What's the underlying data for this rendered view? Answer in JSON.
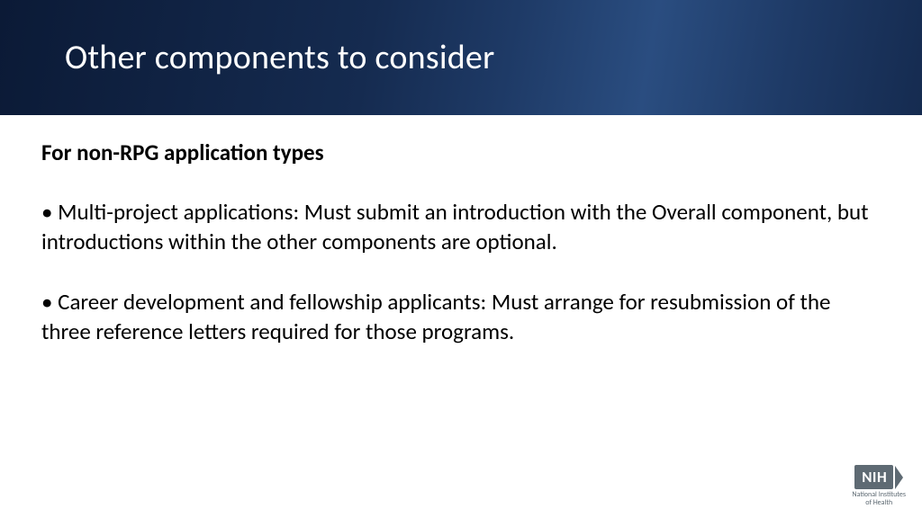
{
  "header": {
    "title": "Other components to consider"
  },
  "content": {
    "subheading": "For non-RPG application types",
    "bullets": [
      "Multi-project applications: Must submit an introduction with the Overall component, but introductions within the other components are optional.",
      "Career development and fellowship applicants: Must arrange for resubmission of the three reference letters required for those programs."
    ]
  },
  "logo": {
    "mark": "NIH",
    "line1": "National Institutes",
    "line2": "of Health"
  }
}
